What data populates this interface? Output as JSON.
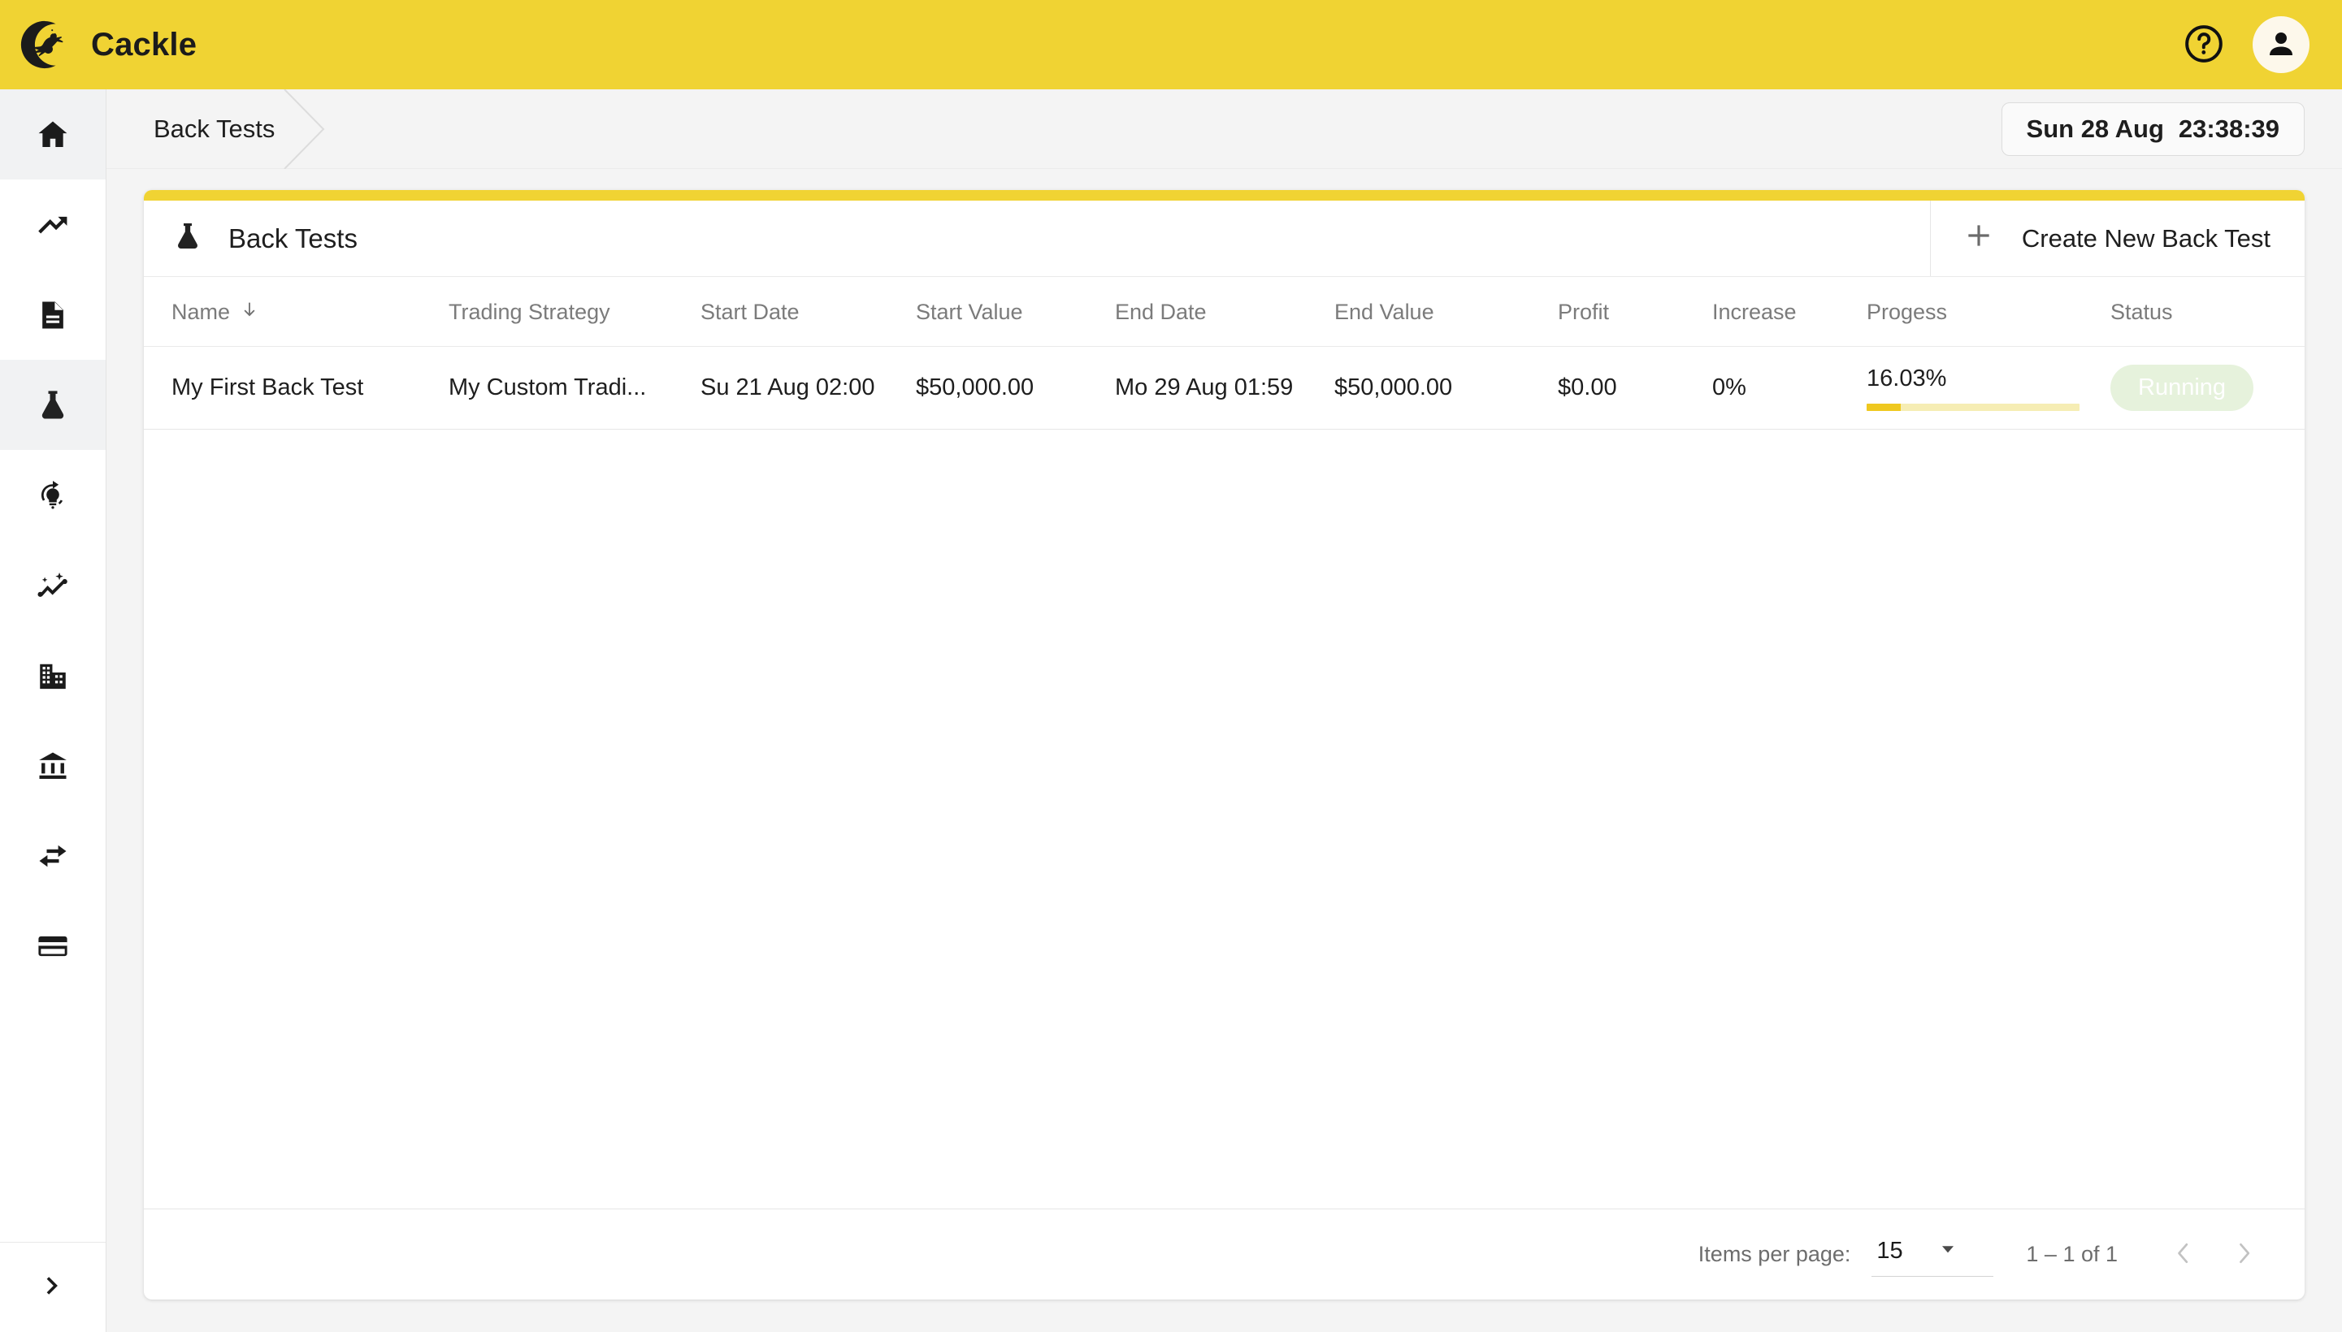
{
  "app": {
    "brand": "Cackle",
    "logo_icon": "witch-on-broom-moon-logo",
    "header_color": "#F0D333"
  },
  "topbar": {
    "help_icon": "help-circle-icon",
    "avatar_icon": "person-icon"
  },
  "breadcrumb": {
    "items": [
      {
        "label": "Back Tests"
      }
    ],
    "arrow_icon": "chevron-right-divider-icon"
  },
  "clock": {
    "date": "Sun 28 Aug",
    "time": "23:38:39"
  },
  "sidebar": {
    "items": [
      {
        "icon": "home-icon",
        "name": "home",
        "active": true
      },
      {
        "icon": "trending-up-icon",
        "name": "trending",
        "active": false
      },
      {
        "icon": "article-icon",
        "name": "articles",
        "active": false
      },
      {
        "icon": "science-flask-icon",
        "name": "back-tests",
        "active": true
      },
      {
        "icon": "lightbulb-refresh-icon",
        "name": "ideas",
        "active": false
      },
      {
        "icon": "insights-icon",
        "name": "insights",
        "active": false
      },
      {
        "icon": "business-building-icon",
        "name": "business",
        "active": false
      },
      {
        "icon": "account-balance-bank-icon",
        "name": "bank",
        "active": false
      },
      {
        "icon": "swap-horizontal-icon",
        "name": "transfers",
        "active": false
      },
      {
        "icon": "credit-card-icon",
        "name": "payments",
        "active": false
      }
    ],
    "expand": {
      "icon": "chevron-right-icon"
    }
  },
  "card": {
    "title": "Back Tests",
    "title_icon": "science-flask-icon",
    "accent_color": "#F0D333",
    "create_button": {
      "label": "Create New Back Test",
      "icon": "plus-icon"
    }
  },
  "table": {
    "columns": [
      {
        "key": "name",
        "label": "Name",
        "sort_icon": "arrow-down-icon",
        "sorted": true
      },
      {
        "key": "strategy",
        "label": "Trading Strategy"
      },
      {
        "key": "start_date",
        "label": "Start Date"
      },
      {
        "key": "start_value",
        "label": "Start Value"
      },
      {
        "key": "end_date",
        "label": "End Date"
      },
      {
        "key": "end_value",
        "label": "End Value"
      },
      {
        "key": "profit",
        "label": "Profit"
      },
      {
        "key": "increase",
        "label": "Increase"
      },
      {
        "key": "progress",
        "label": "Progess"
      },
      {
        "key": "status",
        "label": "Status"
      }
    ],
    "rows": [
      {
        "name": "My First Back Test",
        "strategy": "My Custom Tradi...",
        "start_date": "Su 21 Aug 02:00",
        "start_value": "$50,000.00",
        "end_date": "Mo 29 Aug 01:59",
        "end_value": "$50,000.00",
        "profit": "$0.00",
        "increase": "0%",
        "progress_label": "16.03%",
        "progress_percent": 16.03,
        "status": "Running",
        "status_color": "#E6F2DC",
        "menu_icon": "more-vertical-icon"
      }
    ]
  },
  "paginator": {
    "items_per_page_label": "Items per page:",
    "items_per_page_value": "15",
    "dropdown_icon": "caret-down-icon",
    "range_label": "1 – 1 of 1",
    "prev_icon": "chevron-left-icon",
    "next_icon": "chevron-right-icon"
  }
}
